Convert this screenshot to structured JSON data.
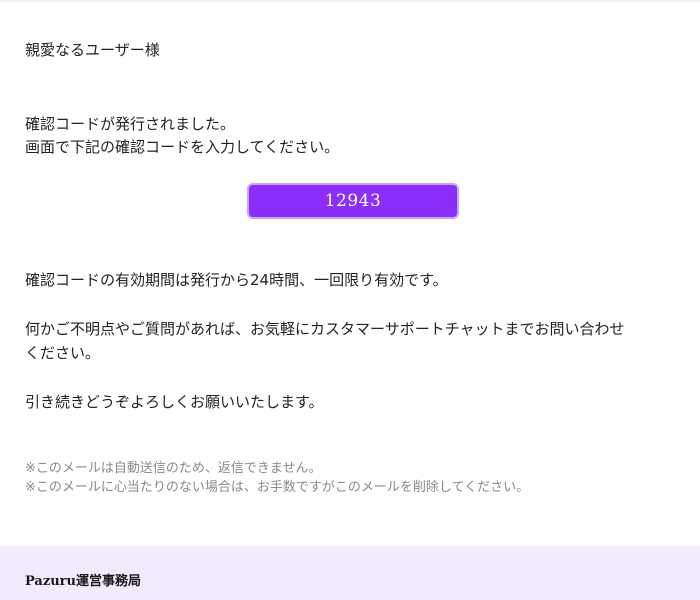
{
  "email": {
    "greeting": "親愛なるユーザー様",
    "intro_line1": "確認コードが発行されました。",
    "intro_line2": "画面で下記の確認コードを入力してください。",
    "verification_code": "12943",
    "validity_text": "確認コードの有効期間は発行から24時間、一回限り有効です。",
    "support_line1": "何かご不明点やご質問があれば、お気軽にカスタマーサポートチャットまでお問い合わせ",
    "support_line2": "ください。",
    "closing": "引き続きどうぞよろしくお願いいたします。",
    "notes": [
      "※このメールは自動送信のため、返信できません。",
      "※このメールに心当たりのない場合は、お手数ですがこのメールを削除してください。"
    ]
  },
  "footer": {
    "sender": "Pazuru運営事務局"
  },
  "colors": {
    "code_background": "#8b2dfb",
    "code_border": "#c7a3ff",
    "footer_background": "#f1ebfd",
    "note_text": "#8a8a8a"
  }
}
